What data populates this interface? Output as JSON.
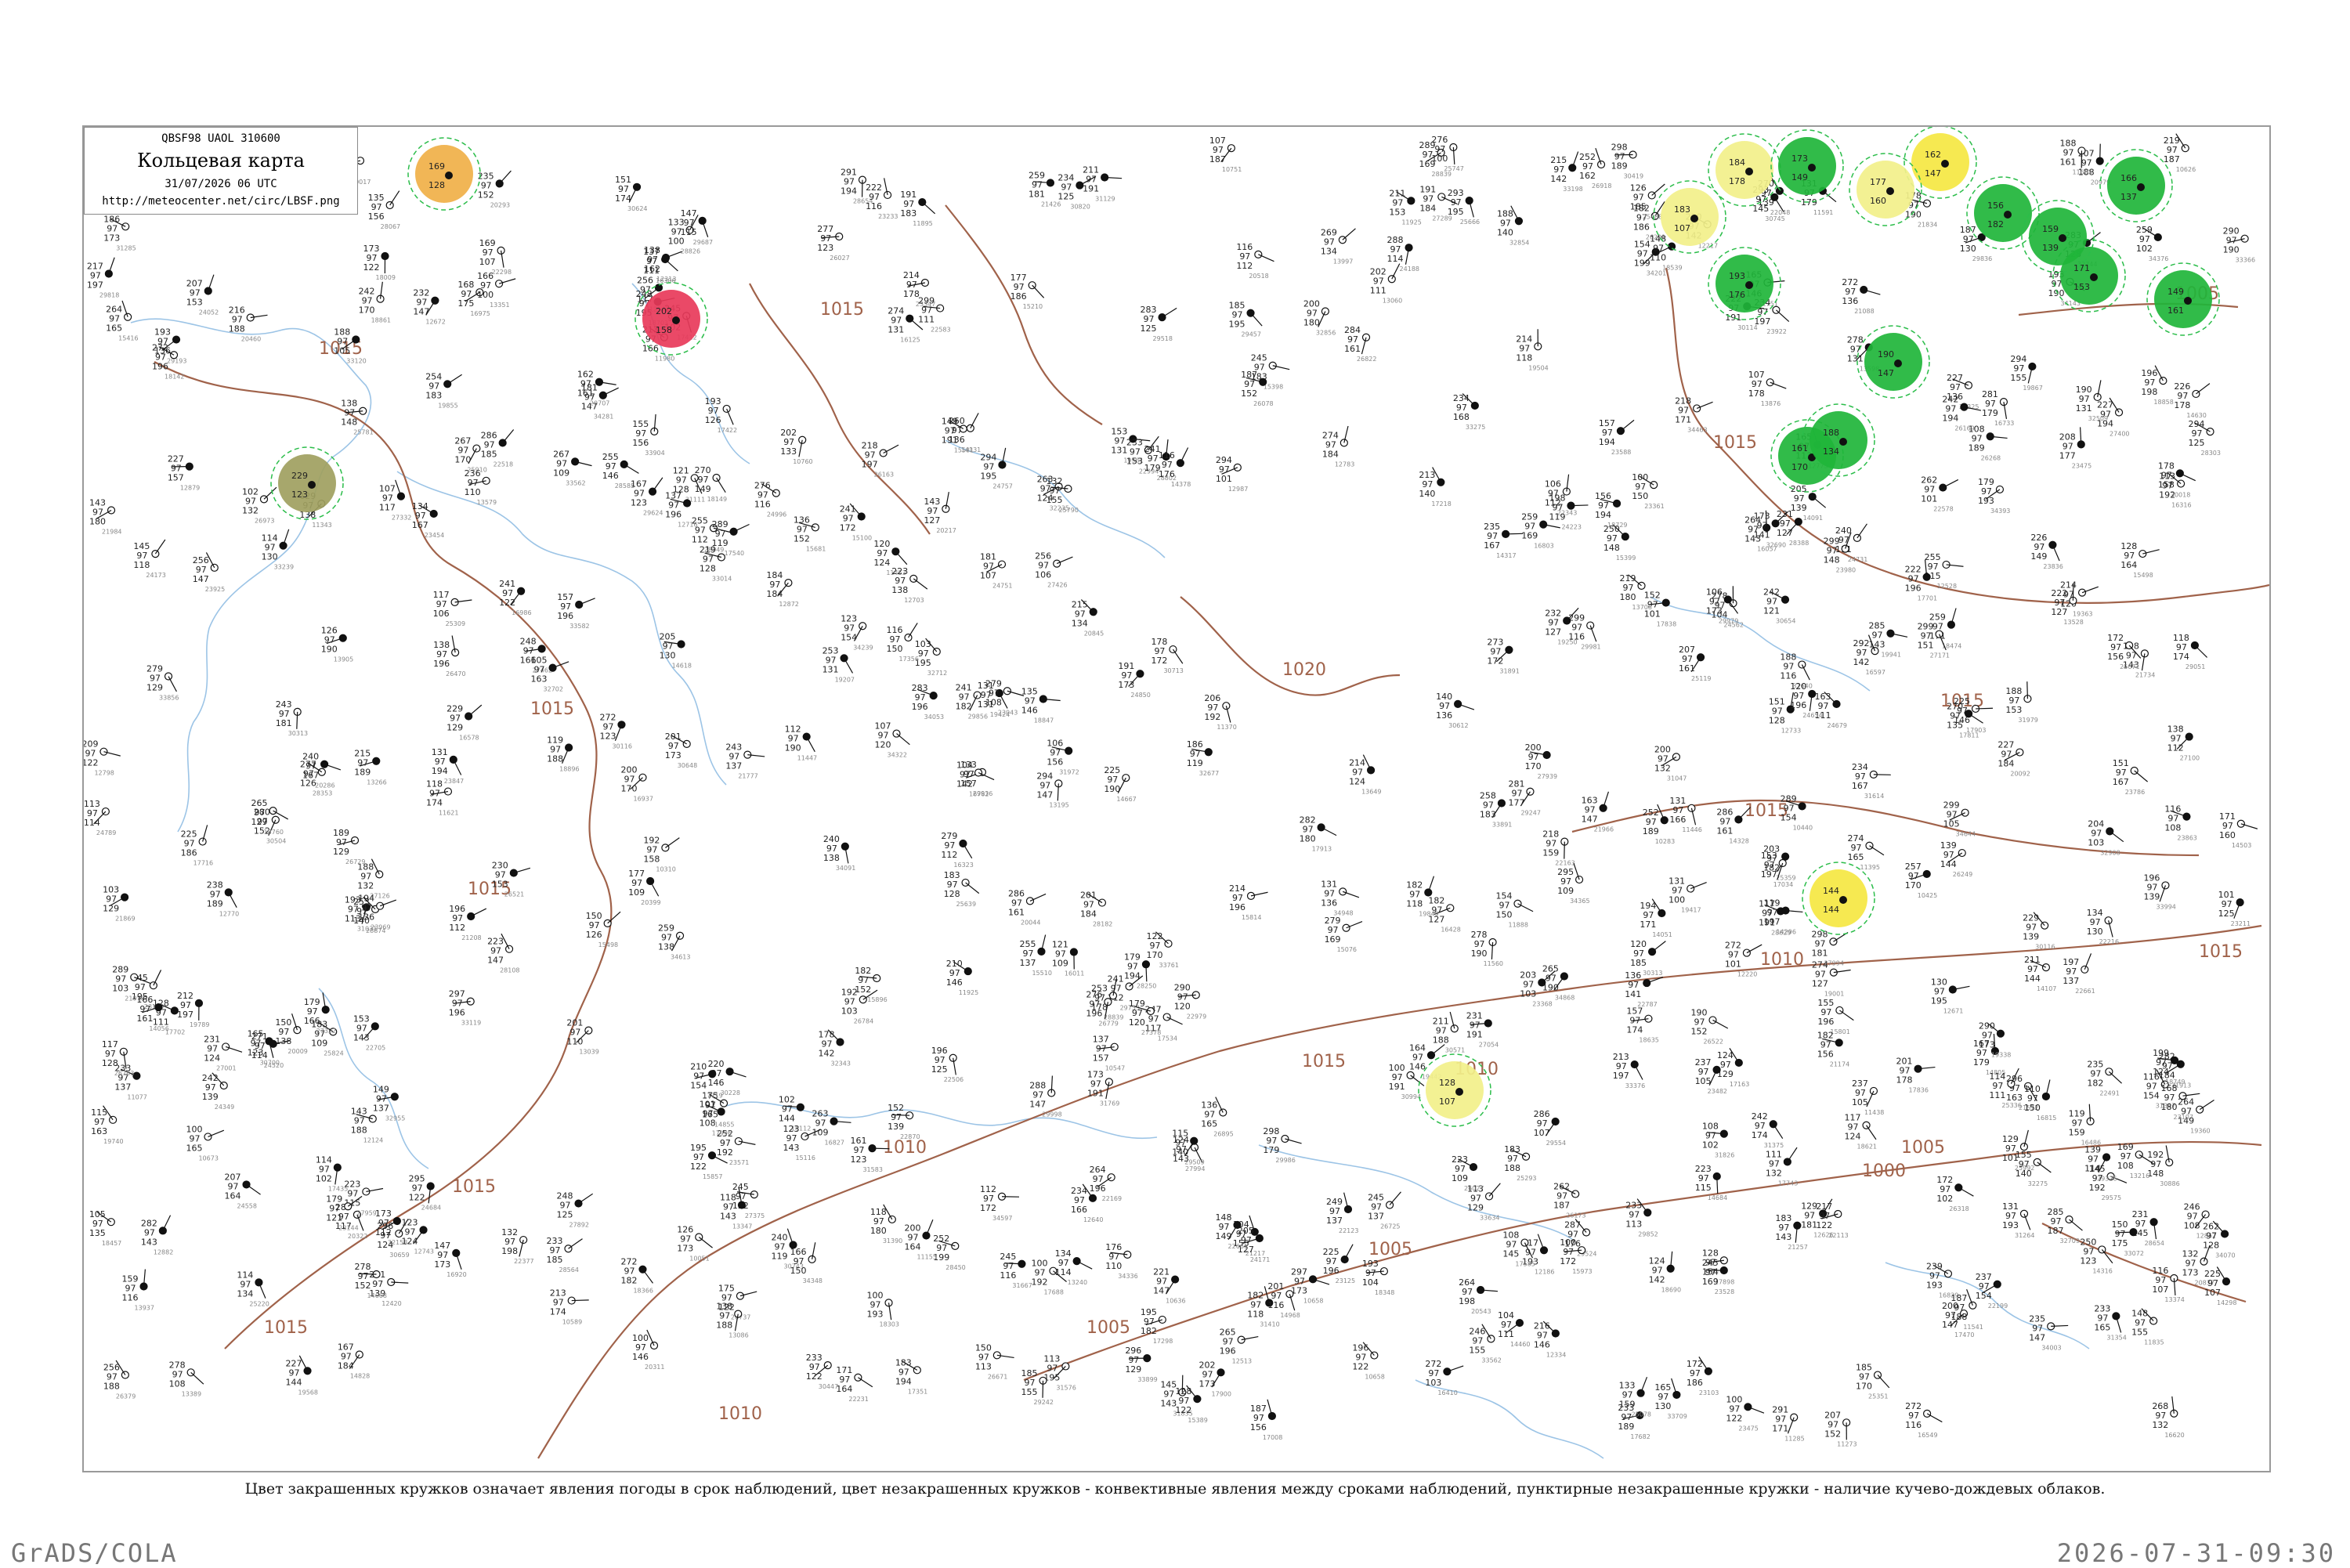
{
  "header": {
    "code": "QBSF98  UAOL  310600",
    "title": "Кольцевая карта",
    "date": "31/07/2026 06 UTC",
    "url": "http://meteocenter.net/circ/LBSF.png"
  },
  "caption": "Цвет закрашенных кружков означает явления погоды в срок наблюдений, цвет незакрашенных кружков - конвективные явления между сроками наблюдений, пунктирные незакрашенные кружки - наличие кучево-дождевых облаков.",
  "footer": {
    "left": "GrADS/COLA",
    "right": "2026-07-31-09:30"
  },
  "isobars": {
    "labels": [
      "1015",
      "1015",
      "1015",
      "1015",
      "1015",
      "1015",
      "1015",
      "1015",
      "1015",
      "1015",
      "1015",
      "1010",
      "1010",
      "1010",
      "1010",
      "1005",
      "1005",
      "1005",
      "1005",
      "1000",
      "1020"
    ]
  },
  "colors": {
    "isobar": "#a0624a",
    "water": "#9cc4e6",
    "rain": "#1fb53a",
    "drizzle": "#f2f08a",
    "thunder": "#f5e742",
    "fog": "#f0b048",
    "severe": "#e83a5a",
    "haze": "#a0a060"
  },
  "stations": [
    {
      "t": "169",
      "p": "128",
      "c": "#f0b048"
    },
    {
      "t": "202",
      "p": "158",
      "c": "#e83a5a"
    },
    {
      "t": "229",
      "p": "123",
      "c": "#a0a060"
    },
    {
      "t": "162",
      "p": "147",
      "c": "#f5e742"
    },
    {
      "t": "184",
      "p": "178",
      "c": "#f2f08a"
    },
    {
      "t": "183",
      "p": "107",
      "c": "#f2f08a"
    },
    {
      "t": "177",
      "p": "160",
      "c": "#f2f08a"
    },
    {
      "t": "144",
      "p": "144",
      "c": "#f5e742"
    },
    {
      "t": "128",
      "p": "107",
      "c": "#f2f08a"
    },
    {
      "t": "173",
      "p": "149",
      "c": "#1fb53a"
    },
    {
      "t": "166",
      "p": "137",
      "c": "#1fb53a"
    },
    {
      "t": "171",
      "p": "153",
      "c": "#1fb53a"
    },
    {
      "t": "193",
      "p": "176",
      "c": "#1fb53a"
    },
    {
      "t": "156",
      "p": "182",
      "c": "#1fb53a"
    },
    {
      "t": "159",
      "p": "139",
      "c": "#1fb53a"
    },
    {
      "t": "190",
      "p": "147",
      "c": "#1fb53a"
    },
    {
      "t": "161",
      "p": "170",
      "c": "#1fb53a"
    },
    {
      "t": "188",
      "p": "134",
      "c": "#1fb53a"
    },
    {
      "t": "149",
      "p": "161",
      "c": "#1fb53a"
    }
  ]
}
